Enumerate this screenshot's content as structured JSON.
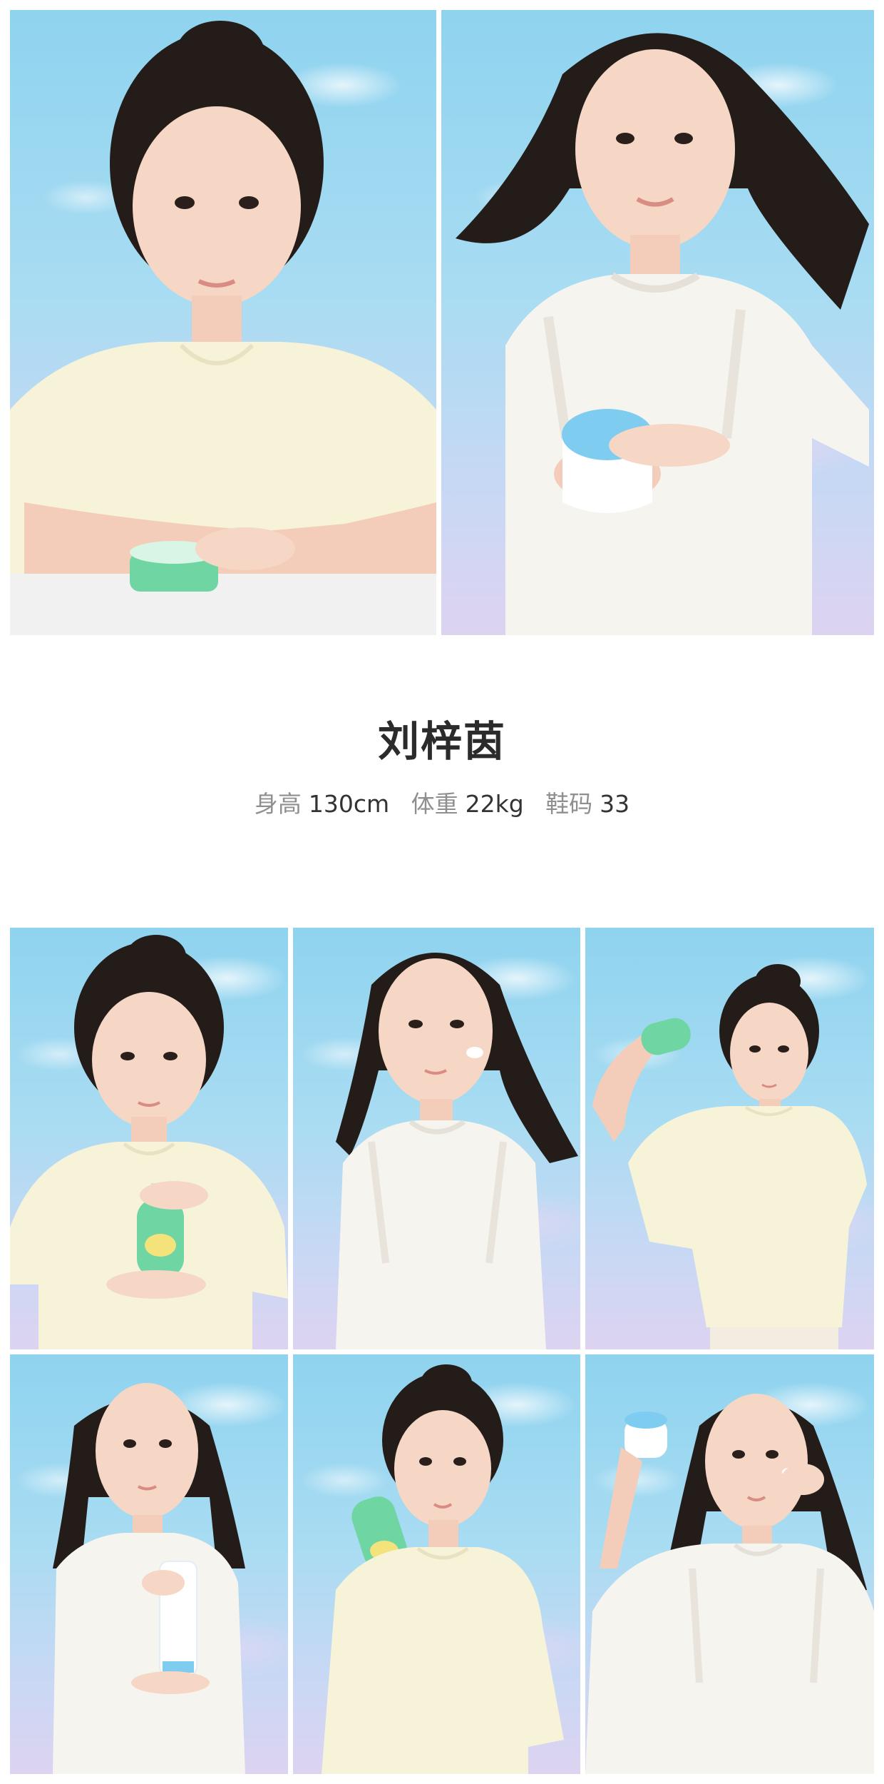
{
  "model": {
    "name": "刘梓茵",
    "stats": [
      {
        "label": "身高",
        "value": "130cm"
      },
      {
        "label": "体重",
        "value": "22kg"
      },
      {
        "label": "鞋码",
        "value": "33"
      }
    ]
  },
  "photos": [
    {
      "slot": "top-left",
      "hair": "bun",
      "outfit": "cream tee",
      "prop": "green cream jar"
    },
    {
      "slot": "top-right",
      "hair": "long",
      "outfit": "white ruffle dress",
      "prop": "blue-lid cream jar"
    },
    {
      "slot": "grid-1",
      "hair": "bun",
      "outfit": "cream tee",
      "prop": "green lotion bottle"
    },
    {
      "slot": "grid-2",
      "hair": "long",
      "outfit": "white ruffle dress",
      "prop": "none"
    },
    {
      "slot": "grid-3",
      "hair": "bun",
      "outfit": "cream tee",
      "prop": "green lotion bottle"
    },
    {
      "slot": "grid-4",
      "hair": "long",
      "outfit": "white ruffle dress",
      "prop": "white lotion bottle"
    },
    {
      "slot": "grid-5",
      "hair": "bun",
      "outfit": "cream tee",
      "prop": "green lotion bottle"
    },
    {
      "slot": "grid-6",
      "hair": "long",
      "outfit": "white ruffle dress",
      "prop": "blue-lid cream jar"
    }
  ],
  "colors": {
    "sky": "#a8dcf2",
    "cream_tee": "#f7f3d9",
    "white_dress": "#f6f4ee",
    "hair": "#231c19",
    "skin": "#f6d6c4",
    "green_product": "#6fd6a3",
    "blue_product": "#7ecdf0"
  }
}
